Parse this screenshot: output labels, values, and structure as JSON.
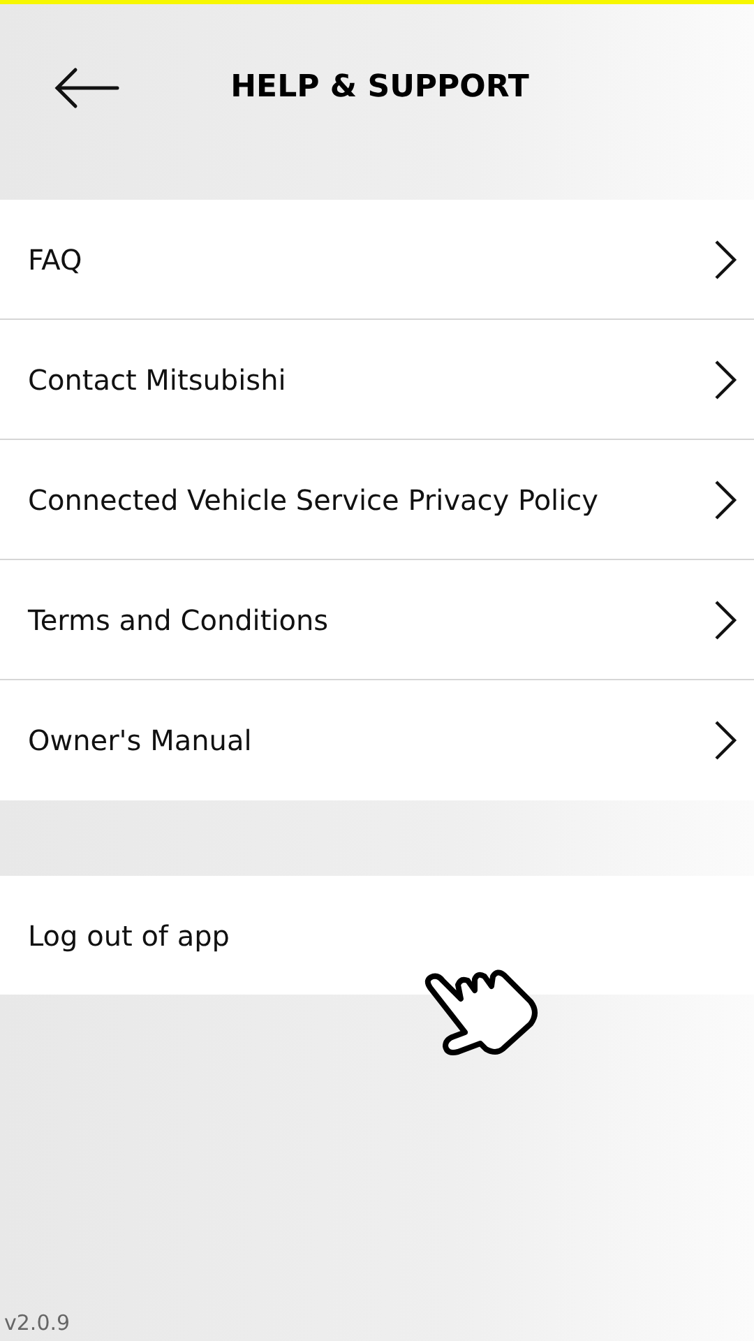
{
  "header": {
    "title": "HELP & SUPPORT"
  },
  "menu_items": [
    {
      "label": "FAQ"
    },
    {
      "label": "Contact Mitsubishi"
    },
    {
      "label": "Connected Vehicle Service Privacy Policy"
    },
    {
      "label": "Terms and Conditions"
    },
    {
      "label": "Owner's Manual"
    }
  ],
  "logout": {
    "label": "Log out of app"
  },
  "version": "v2.0.9"
}
